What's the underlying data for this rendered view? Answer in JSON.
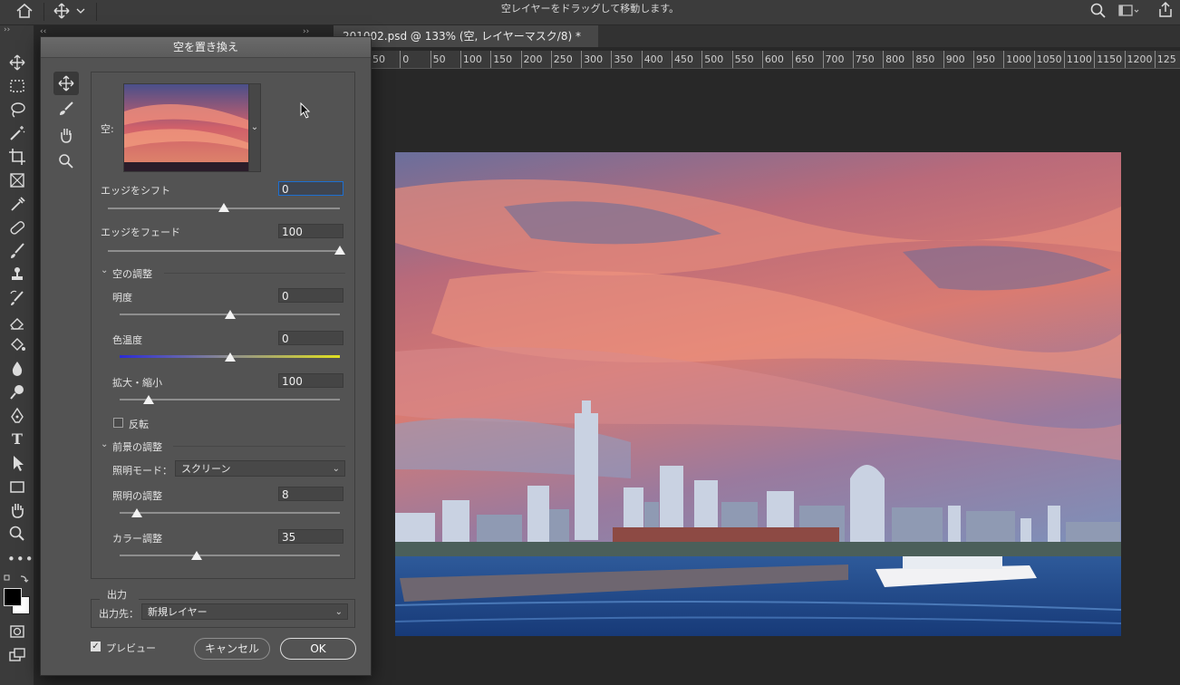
{
  "top_bar": {
    "status_text": "空レイヤーをドラッグして移動します。"
  },
  "document": {
    "tab_title": "201002.psd @ 133% (空, レイヤーマスク/8) *",
    "ruler_ticks": [
      "50",
      "0",
      "50",
      "100",
      "150",
      "200",
      "250",
      "300",
      "350",
      "400",
      "450",
      "500",
      "550",
      "600",
      "650",
      "700",
      "750",
      "800",
      "850",
      "900",
      "950",
      "1000",
      "1050",
      "1100",
      "1150",
      "1200",
      "125"
    ]
  },
  "dialog": {
    "title": "空を置き換え",
    "sky_label": "空:",
    "edge_shift": {
      "label": "エッジをシフト",
      "value": "0",
      "level": 0.5
    },
    "edge_fade": {
      "label": "エッジをフェード",
      "value": "100",
      "level": 1.0
    },
    "sky_adjust": {
      "header": "空の調整",
      "brightness": {
        "label": "明度",
        "value": "0",
        "level": 0.5
      },
      "temperature": {
        "label": "色温度",
        "value": "0",
        "level": 0.5
      },
      "scale": {
        "label": "拡大・縮小",
        "value": "100",
        "level": 0.13
      },
      "flip_label": "反転"
    },
    "foreground_adjust": {
      "header": "前景の調整",
      "lighting_mode_label": "照明モード：",
      "lighting_mode_value": "スクリーン",
      "lighting": {
        "label": "照明の調整",
        "value": "8",
        "level": 0.08
      },
      "color": {
        "label": "カラー調整",
        "value": "35",
        "level": 0.35
      }
    },
    "output": {
      "header": "出力",
      "label": "出力先：",
      "value": "新規レイヤー"
    },
    "preview_label": "プレビュー",
    "cancel_label": "キャンセル",
    "ok_label": "OK"
  },
  "colors": {
    "accent": "#1d6fd1",
    "panel_bg": "#535353",
    "app_bg": "#282828"
  }
}
